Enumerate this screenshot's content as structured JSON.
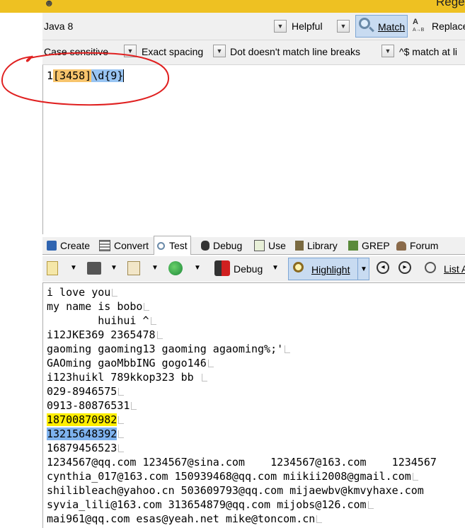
{
  "window": {
    "title_fragment": "Rege"
  },
  "toolbar1": {
    "flavor": "Java 8",
    "helper": "Helpful",
    "match_label": "Match",
    "replace_label": "Replace"
  },
  "toolbar2": {
    "case_option": "Case sensitive",
    "spacing_option": "Exact spacing",
    "dot_option": "Dot doesn't match line breaks",
    "anchor_option": "^$ match at li"
  },
  "regex": {
    "prefix": "1",
    "class_part": "[3458]",
    "digit_part": "\\d{9}"
  },
  "tabs": [
    "Create",
    "Convert",
    "Test",
    "Debug",
    "Use",
    "Library",
    "GREP",
    "Forum"
  ],
  "test_toolbar": {
    "debug_label": "Debug",
    "highlight_label": "Highlight",
    "list_label": "List A"
  },
  "test_lines": [
    "i love you",
    "my name is bobo",
    "        huihui ^",
    "i12JKE369 2365478",
    "gaoming gaoming13 gaoming agaoming%;'",
    "GAOming gaoMbbING gogo146",
    "i123huikl 789kkop323 bb ",
    "029-8946575",
    "0913-80876531",
    "18700870982",
    "13215648392",
    "16879456523",
    "1234567@qq.com 1234567@sina.com    1234567@163.com    1234567",
    "cynthia_017@163.com 150939468@qq.com miikii2008@gmail.com",
    "shilibleach@yahoo.cn 503609793@qq.com mijaewbv@kmvyhaxe.com",
    "syvia_lili@163.com 313654879@qq.com mijobs@126.com",
    "mai961@qq.com esas@yeah.net mike@toncom.cn"
  ]
}
